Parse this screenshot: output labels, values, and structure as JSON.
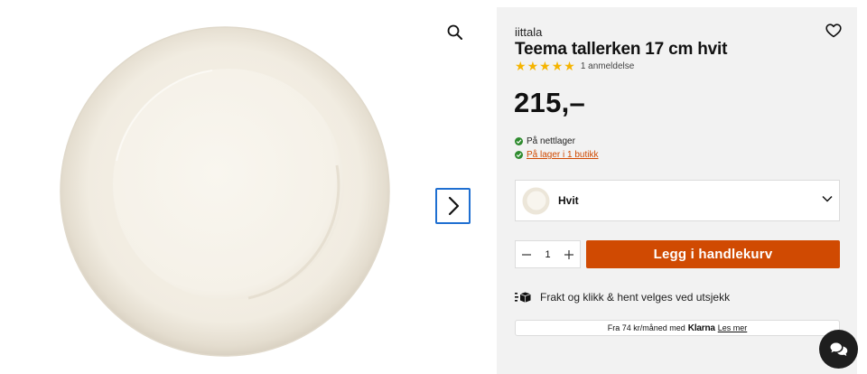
{
  "product": {
    "brand": "iittala",
    "title": "Teema tallerken 17 cm hvit",
    "rating": 5,
    "reviews_label": "1 anmeldelse",
    "price": "215,–",
    "image_alt": "Teema tallerken hvit"
  },
  "stock": {
    "online": "På nettlager",
    "in_store": "På lager i 1 butikk"
  },
  "variant": {
    "selected": "Hvit"
  },
  "cart": {
    "quantity": "1",
    "add_label": "Legg i handlekurv"
  },
  "shipping": {
    "text": "Frakt og klikk & hent velges ved utsjekk"
  },
  "klarna": {
    "text": "Fra 74 kr/måned med",
    "logo": "Klarna",
    "link": "Les mer"
  },
  "icons": {
    "zoom": "search-icon",
    "next": "chevron-right-icon",
    "favorite": "heart-icon",
    "variant_dropdown": "chevron-down-icon",
    "decrease": "minus-icon",
    "increase": "plus-icon",
    "shipping": "package-icon",
    "chat": "chat-icon",
    "stock": "check-circle-icon"
  },
  "colors": {
    "accent": "#d04a02",
    "star": "#f5b400",
    "stock_ok": "#2e8b2e",
    "panel_bg": "#f2f2f2",
    "focus": "#1f6fd1"
  }
}
